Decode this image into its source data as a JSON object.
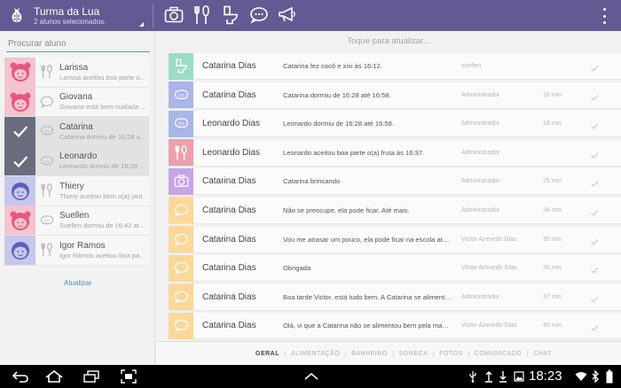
{
  "header": {
    "title": "Turma da Lua",
    "subtitle": "2 alunos selecionados.",
    "actions": [
      "camera-icon",
      "food-icon",
      "toilet-icon",
      "chat-bubble-icon",
      "megaphone-icon",
      "overflow-menu-icon"
    ],
    "accent_color": "#635a94"
  },
  "search": {
    "placeholder": "Procurar aluno"
  },
  "students": [
    {
      "name": "Larissa",
      "preview": "Larissa aceitou boa parte o...",
      "avatar": "girl",
      "selected": false,
      "status_icon": "food-icon"
    },
    {
      "name": "Giovana",
      "preview": "Giovana está bem cuidada ...",
      "avatar": "girl",
      "selected": false,
      "status_icon": "chat-bubble-icon"
    },
    {
      "name": "Catarina",
      "preview": "Catarina dormiu de 16:28 até...",
      "avatar": "girl",
      "selected": true,
      "status_icon": "sleep-icon"
    },
    {
      "name": "Leonardo",
      "preview": "Leonardo dormiu de 16:28 até...",
      "avatar": "boy",
      "selected": true,
      "status_icon": "sleep-icon"
    },
    {
      "name": "Thiery",
      "preview": "Thiery aceitou bem o(a) jant...",
      "avatar": "boy",
      "selected": false,
      "status_icon": "food-icon"
    },
    {
      "name": "Suellen",
      "preview": "Suellen dormiu de 16:42 até ...",
      "avatar": "girl",
      "selected": false,
      "status_icon": "sleep-icon"
    },
    {
      "name": "Igor Ramos",
      "preview": "Igor Ramos aceitou boa part...",
      "avatar": "boy",
      "selected": false,
      "status_icon": "food-icon"
    }
  ],
  "left_footer": {
    "update_label": "Atualizar"
  },
  "feed": {
    "refresh_hint": "Toque para atualizar...",
    "items": [
      {
        "name": "Catarina Dias",
        "message": "Catarina fez cocô e xixi às 16:12.",
        "author": "suellen",
        "time": "",
        "type": "toilet",
        "color": "#9adcc6"
      },
      {
        "name": "Catarina Dias",
        "message": "Catarina  dormiu de 16:28 até 16:58.",
        "author": "Administrador",
        "time": "18 min",
        "type": "sleep",
        "color": "#a8b6e8"
      },
      {
        "name": "Leonardo Dias",
        "message": "Leonardo  dormiu de 16:28 até 16:58.",
        "author": "Administrador",
        "time": "18 min",
        "type": "sleep",
        "color": "#a8b6e8"
      },
      {
        "name": "Leonardo Dias",
        "message": "Leonardo aceitou boa parte o(a) fruta às 16:37.",
        "author": "Administrador",
        "time": "",
        "type": "food",
        "color": "#eba0ab"
      },
      {
        "name": "Catarina Dias",
        "message": "Catarina brincando",
        "author": "Administrador",
        "time": "25 min",
        "type": "photo",
        "color": "#c7a5e6"
      },
      {
        "name": "Catarina Dias",
        "message": "Não se preocupe, ela pode ficar. Até mais.",
        "author": "Administrador",
        "time": "34 min",
        "type": "chat",
        "color": "#fbd89a"
      },
      {
        "name": "Catarina Dias",
        "message": "Vou me atrasar um pouco, ela pode ficar na escola até...",
        "author": "Victor Azevedo Dias",
        "time": "35 min",
        "type": "chat",
        "color": "#fbd89a"
      },
      {
        "name": "Catarina Dias",
        "message": "Obrigada",
        "author": "Victor Azevedo Dias",
        "time": "36 min",
        "type": "chat",
        "color": "#fbd89a"
      },
      {
        "name": "Catarina Dias",
        "message": "Boa tarde Victor, está tudo bem. A Catarina se alimento...",
        "author": "Administrador",
        "time": "37 min",
        "type": "chat",
        "color": "#fbd89a"
      },
      {
        "name": "Catarina Dias",
        "message": "Olá, vi que a Catarina não se alimentou bem pela manh...",
        "author": "Victor Azevedo Dias",
        "time": "40 min",
        "type": "chat",
        "color": "#fbd89a"
      }
    ]
  },
  "tabs": [
    {
      "label": "GERAL",
      "active": true
    },
    {
      "label": "ALIMENTAÇÃO",
      "active": false
    },
    {
      "label": "BANHEIRO",
      "active": false
    },
    {
      "label": "SONECA",
      "active": false
    },
    {
      "label": "FOTOS",
      "active": false
    },
    {
      "label": "COMUNICADO",
      "active": false
    },
    {
      "label": "CHAT",
      "active": false
    }
  ],
  "system_bar": {
    "clock": "18:23",
    "nav_icons": [
      "back-icon",
      "home-icon",
      "recent-apps-icon",
      "screenshot-icon",
      "up-chevron-icon"
    ],
    "status_icons": [
      "usb-icon",
      "upload-icon",
      "download-icon",
      "image-icon",
      "wifi-icon",
      "bluetooth-icon",
      "battery-icon"
    ]
  }
}
